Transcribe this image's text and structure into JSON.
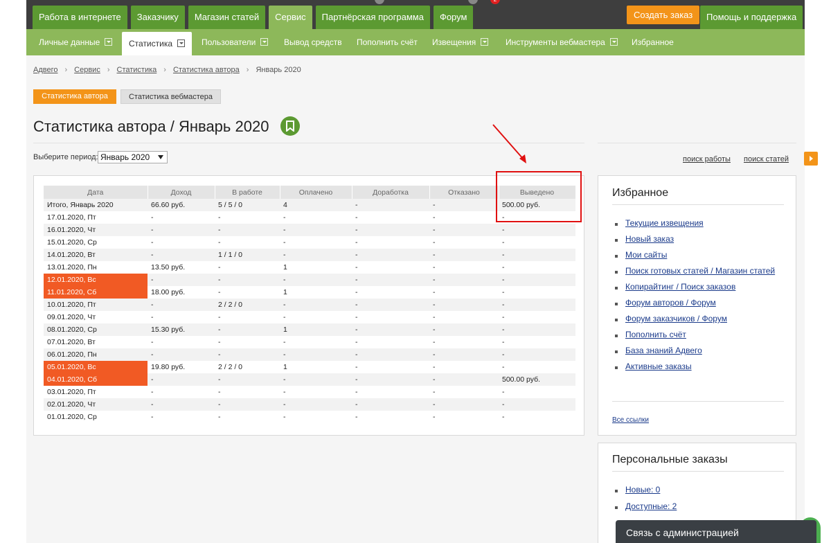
{
  "top_nav": {
    "tabs": [
      "Работа в интернете",
      "Заказчику",
      "Магазин статей",
      "Сервис",
      "Партнёрская программа",
      "Форум"
    ],
    "active": "Сервис",
    "badges": [
      "",
      "",
      "2"
    ],
    "create_order": "Создать заказ",
    "help": "Помощь и поддержка"
  },
  "sub_nav": {
    "items": [
      "Личные данные",
      "Статистика",
      "Пользователи",
      "Вывод средств",
      "Пополнить счёт",
      "Извещения",
      "Инструменты вебмастера",
      "Избранное"
    ],
    "active": "Статистика"
  },
  "breadcrumbs": [
    "Адвего",
    "Сервис",
    "Статистика",
    "Статистика автора",
    "Январь 2020"
  ],
  "view_tabs": {
    "author": "Статистика автора",
    "webmaster": "Статистика вебмастера"
  },
  "page_title": "Статистика автора / Январь 2020",
  "period": {
    "label": "Выберите период:",
    "value": "Январь 2020"
  },
  "links": {
    "search_work": "поиск работы",
    "search_articles": "поиск статей"
  },
  "table": {
    "headers": [
      "Дата",
      "Доход",
      "В работе",
      "Оплачено",
      "Доработка",
      "Отказано",
      "Выведено"
    ],
    "rows": [
      [
        "Итого, Январь 2020",
        "66.60 руб.",
        "5 / 5 / 0",
        "4",
        "-",
        "-",
        "500.00 руб."
      ],
      [
        "17.01.2020, Пт",
        "-",
        "-",
        "-",
        "-",
        "-",
        "-"
      ],
      [
        "16.01.2020, Чт",
        "-",
        "-",
        "-",
        "-",
        "-",
        "-"
      ],
      [
        "15.01.2020, Ср",
        "-",
        "-",
        "-",
        "-",
        "-",
        "-"
      ],
      [
        "14.01.2020, Вт",
        "-",
        "1 / 1 / 0",
        "-",
        "-",
        "-",
        "-"
      ],
      [
        "13.01.2020, Пн",
        "13.50 руб.",
        "-",
        "1",
        "-",
        "-",
        "-"
      ],
      [
        "12.01.2020, Вс",
        "-",
        "-",
        "-",
        "-",
        "-",
        "-"
      ],
      [
        "11.01.2020, Сб",
        "18.00 руб.",
        "-",
        "1",
        "-",
        "-",
        "-"
      ],
      [
        "10.01.2020, Пт",
        "-",
        "2 / 2 / 0",
        "-",
        "-",
        "-",
        "-"
      ],
      [
        "09.01.2020, Чт",
        "-",
        "-",
        "-",
        "-",
        "-",
        "-"
      ],
      [
        "08.01.2020, Ср",
        "15.30 руб.",
        "-",
        "1",
        "-",
        "-",
        "-"
      ],
      [
        "07.01.2020, Вт",
        "-",
        "-",
        "-",
        "-",
        "-",
        "-"
      ],
      [
        "06.01.2020, Пн",
        "-",
        "-",
        "-",
        "-",
        "-",
        "-"
      ],
      [
        "05.01.2020, Вс",
        "19.80 руб.",
        "2 / 2 / 0",
        "1",
        "-",
        "-",
        "-"
      ],
      [
        "04.01.2020, Сб",
        "-",
        "-",
        "-",
        "-",
        "-",
        "500.00 руб."
      ],
      [
        "03.01.2020, Пт",
        "-",
        "-",
        "-",
        "-",
        "-",
        "-"
      ],
      [
        "02.01.2020, Чт",
        "-",
        "-",
        "-",
        "-",
        "-",
        "-"
      ],
      [
        "01.01.2020, Ср",
        "-",
        "-",
        "-",
        "-",
        "-",
        "-"
      ]
    ],
    "weekend_rows": [
      6,
      7,
      13,
      14
    ],
    "weekend_color": "#f15a24"
  },
  "favorites": {
    "title": "Избранное",
    "items": [
      "Текущие извещения",
      "Новый заказ",
      "Мои сайты",
      "Поиск готовых статей / Магазин статей",
      "Копирайтинг / Поиск заказов",
      "Форум авторов / Форум",
      "Форум заказчиков / Форум",
      "Пополнить счёт",
      "База знаний Адвего",
      "Активные заказы"
    ],
    "all_links": "Все ссылки"
  },
  "personal_orders": {
    "title": "Персональные заказы",
    "items": [
      "Новые: 0",
      "Доступные: 2"
    ]
  },
  "contact_admin": "Связь с администрацией",
  "colors": {
    "green_dark": "#5c9a32",
    "green_light": "#8db85a",
    "orange": "#f39419",
    "red_annotation": "#e01010"
  }
}
